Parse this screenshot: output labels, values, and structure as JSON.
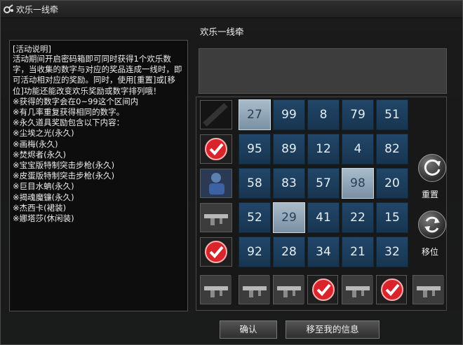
{
  "window": {
    "title": "欢乐一线牵"
  },
  "info": {
    "heading": "[活动说明]",
    "body": "活动期间开启密码箱即可同时获得1个欢乐数字，当收集的数字与对应的奖品连成一线时，即可活动相对应的奖励。同时，使用[重置]或[移位]功能还能改变欢乐奖励或数字排列哦！\n※获得的数字会在0~99这个区间内\n※有几率重复获得相同的数字。\n※永久道具奖励包含以下内容：\n※尘埃之光(永久)\n※画梅(永久)\n※焚烬者(永久)\n※宝宝版特制突击步枪(永久)\n※皮蛋版特制突击步枪(永久)\n※巨目水蚺(永久)\n※揭魂魔镰(永久)\n※杰西卡(裙装)\n※娜塔莎(休闲装)"
  },
  "panel_title": "欢乐一线牵",
  "grid": {
    "rows": [
      [
        {
          "n": "27",
          "lit": true
        },
        {
          "n": "99",
          "lit": false
        },
        {
          "n": "8",
          "lit": false
        },
        {
          "n": "79",
          "lit": false
        },
        {
          "n": "51",
          "lit": false
        }
      ],
      [
        {
          "n": "95",
          "lit": false
        },
        {
          "n": "89",
          "lit": false
        },
        {
          "n": "12",
          "lit": false
        },
        {
          "n": "4",
          "lit": false
        },
        {
          "n": "82",
          "lit": false
        }
      ],
      [
        {
          "n": "58",
          "lit": false
        },
        {
          "n": "83",
          "lit": false
        },
        {
          "n": "57",
          "lit": false
        },
        {
          "n": "98",
          "lit": true
        },
        {
          "n": "20",
          "lit": false
        }
      ],
      [
        {
          "n": "52",
          "lit": false
        },
        {
          "n": "29",
          "lit": true
        },
        {
          "n": "41",
          "lit": false
        },
        {
          "n": "22",
          "lit": false
        },
        {
          "n": "15",
          "lit": false
        }
      ],
      [
        {
          "n": "92",
          "lit": false
        },
        {
          "n": "28",
          "lit": false
        },
        {
          "n": "34",
          "lit": false
        },
        {
          "n": "21",
          "lit": false
        },
        {
          "n": "32",
          "lit": false
        }
      ]
    ]
  },
  "row_rewards": [
    "dark-item",
    "checkmark",
    "character",
    "rifle",
    "checkmark"
  ],
  "column_rewards": [
    "rifle",
    "rifle",
    "rifle",
    "checkmark",
    "rifle",
    "checkmark",
    "rifle"
  ],
  "controls": {
    "reset_label": "重置",
    "shift_label": "移位"
  },
  "buttons": {
    "confirm": "确认",
    "move_to_info": "移至我的信息"
  },
  "colors": {
    "cell": "#1d3f5f",
    "cell_lit": "#9fb3c3",
    "check": "#d8242a"
  }
}
